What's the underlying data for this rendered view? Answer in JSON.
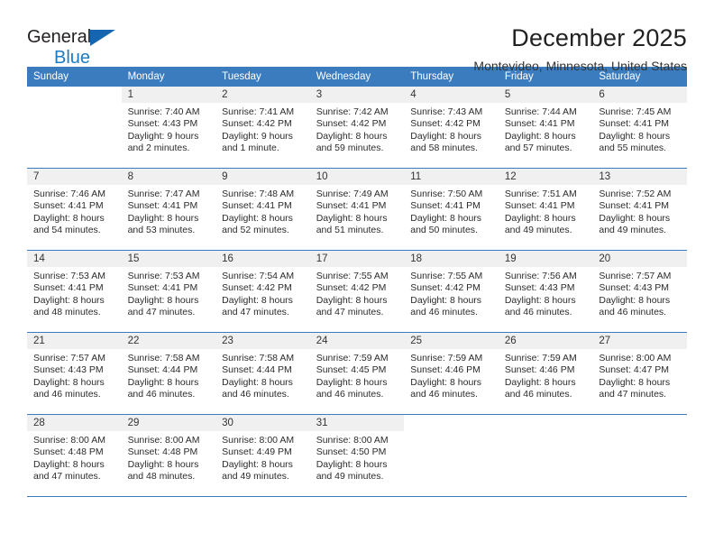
{
  "brand": {
    "name_top": "General",
    "name_bottom": "Blue",
    "triangle_color": "#1565b0",
    "bottom_color": "#1a7bc4"
  },
  "header": {
    "title": "December 2025",
    "subtitle": "Montevideo, Minnesota, United States"
  },
  "colors": {
    "header_band": "#3a7cbe",
    "daynum_band": "#f0f0f0",
    "text": "#222222"
  },
  "weekday_headers": [
    "Sunday",
    "Monday",
    "Tuesday",
    "Wednesday",
    "Thursday",
    "Friday",
    "Saturday"
  ],
  "weeks": [
    [
      {
        "day": "",
        "sunrise": "",
        "sunset": "",
        "daylight_1": "",
        "daylight_2": ""
      },
      {
        "day": "1",
        "sunrise": "Sunrise: 7:40 AM",
        "sunset": "Sunset: 4:43 PM",
        "daylight_1": "Daylight: 9 hours",
        "daylight_2": "and 2 minutes."
      },
      {
        "day": "2",
        "sunrise": "Sunrise: 7:41 AM",
        "sunset": "Sunset: 4:42 PM",
        "daylight_1": "Daylight: 9 hours",
        "daylight_2": "and 1 minute."
      },
      {
        "day": "3",
        "sunrise": "Sunrise: 7:42 AM",
        "sunset": "Sunset: 4:42 PM",
        "daylight_1": "Daylight: 8 hours",
        "daylight_2": "and 59 minutes."
      },
      {
        "day": "4",
        "sunrise": "Sunrise: 7:43 AM",
        "sunset": "Sunset: 4:42 PM",
        "daylight_1": "Daylight: 8 hours",
        "daylight_2": "and 58 minutes."
      },
      {
        "day": "5",
        "sunrise": "Sunrise: 7:44 AM",
        "sunset": "Sunset: 4:41 PM",
        "daylight_1": "Daylight: 8 hours",
        "daylight_2": "and 57 minutes."
      },
      {
        "day": "6",
        "sunrise": "Sunrise: 7:45 AM",
        "sunset": "Sunset: 4:41 PM",
        "daylight_1": "Daylight: 8 hours",
        "daylight_2": "and 55 minutes."
      }
    ],
    [
      {
        "day": "7",
        "sunrise": "Sunrise: 7:46 AM",
        "sunset": "Sunset: 4:41 PM",
        "daylight_1": "Daylight: 8 hours",
        "daylight_2": "and 54 minutes."
      },
      {
        "day": "8",
        "sunrise": "Sunrise: 7:47 AM",
        "sunset": "Sunset: 4:41 PM",
        "daylight_1": "Daylight: 8 hours",
        "daylight_2": "and 53 minutes."
      },
      {
        "day": "9",
        "sunrise": "Sunrise: 7:48 AM",
        "sunset": "Sunset: 4:41 PM",
        "daylight_1": "Daylight: 8 hours",
        "daylight_2": "and 52 minutes."
      },
      {
        "day": "10",
        "sunrise": "Sunrise: 7:49 AM",
        "sunset": "Sunset: 4:41 PM",
        "daylight_1": "Daylight: 8 hours",
        "daylight_2": "and 51 minutes."
      },
      {
        "day": "11",
        "sunrise": "Sunrise: 7:50 AM",
        "sunset": "Sunset: 4:41 PM",
        "daylight_1": "Daylight: 8 hours",
        "daylight_2": "and 50 minutes."
      },
      {
        "day": "12",
        "sunrise": "Sunrise: 7:51 AM",
        "sunset": "Sunset: 4:41 PM",
        "daylight_1": "Daylight: 8 hours",
        "daylight_2": "and 49 minutes."
      },
      {
        "day": "13",
        "sunrise": "Sunrise: 7:52 AM",
        "sunset": "Sunset: 4:41 PM",
        "daylight_1": "Daylight: 8 hours",
        "daylight_2": "and 49 minutes."
      }
    ],
    [
      {
        "day": "14",
        "sunrise": "Sunrise: 7:53 AM",
        "sunset": "Sunset: 4:41 PM",
        "daylight_1": "Daylight: 8 hours",
        "daylight_2": "and 48 minutes."
      },
      {
        "day": "15",
        "sunrise": "Sunrise: 7:53 AM",
        "sunset": "Sunset: 4:41 PM",
        "daylight_1": "Daylight: 8 hours",
        "daylight_2": "and 47 minutes."
      },
      {
        "day": "16",
        "sunrise": "Sunrise: 7:54 AM",
        "sunset": "Sunset: 4:42 PM",
        "daylight_1": "Daylight: 8 hours",
        "daylight_2": "and 47 minutes."
      },
      {
        "day": "17",
        "sunrise": "Sunrise: 7:55 AM",
        "sunset": "Sunset: 4:42 PM",
        "daylight_1": "Daylight: 8 hours",
        "daylight_2": "and 47 minutes."
      },
      {
        "day": "18",
        "sunrise": "Sunrise: 7:55 AM",
        "sunset": "Sunset: 4:42 PM",
        "daylight_1": "Daylight: 8 hours",
        "daylight_2": "and 46 minutes."
      },
      {
        "day": "19",
        "sunrise": "Sunrise: 7:56 AM",
        "sunset": "Sunset: 4:43 PM",
        "daylight_1": "Daylight: 8 hours",
        "daylight_2": "and 46 minutes."
      },
      {
        "day": "20",
        "sunrise": "Sunrise: 7:57 AM",
        "sunset": "Sunset: 4:43 PM",
        "daylight_1": "Daylight: 8 hours",
        "daylight_2": "and 46 minutes."
      }
    ],
    [
      {
        "day": "21",
        "sunrise": "Sunrise: 7:57 AM",
        "sunset": "Sunset: 4:43 PM",
        "daylight_1": "Daylight: 8 hours",
        "daylight_2": "and 46 minutes."
      },
      {
        "day": "22",
        "sunrise": "Sunrise: 7:58 AM",
        "sunset": "Sunset: 4:44 PM",
        "daylight_1": "Daylight: 8 hours",
        "daylight_2": "and 46 minutes."
      },
      {
        "day": "23",
        "sunrise": "Sunrise: 7:58 AM",
        "sunset": "Sunset: 4:44 PM",
        "daylight_1": "Daylight: 8 hours",
        "daylight_2": "and 46 minutes."
      },
      {
        "day": "24",
        "sunrise": "Sunrise: 7:59 AM",
        "sunset": "Sunset: 4:45 PM",
        "daylight_1": "Daylight: 8 hours",
        "daylight_2": "and 46 minutes."
      },
      {
        "day": "25",
        "sunrise": "Sunrise: 7:59 AM",
        "sunset": "Sunset: 4:46 PM",
        "daylight_1": "Daylight: 8 hours",
        "daylight_2": "and 46 minutes."
      },
      {
        "day": "26",
        "sunrise": "Sunrise: 7:59 AM",
        "sunset": "Sunset: 4:46 PM",
        "daylight_1": "Daylight: 8 hours",
        "daylight_2": "and 46 minutes."
      },
      {
        "day": "27",
        "sunrise": "Sunrise: 8:00 AM",
        "sunset": "Sunset: 4:47 PM",
        "daylight_1": "Daylight: 8 hours",
        "daylight_2": "and 47 minutes."
      }
    ],
    [
      {
        "day": "28",
        "sunrise": "Sunrise: 8:00 AM",
        "sunset": "Sunset: 4:48 PM",
        "daylight_1": "Daylight: 8 hours",
        "daylight_2": "and 47 minutes."
      },
      {
        "day": "29",
        "sunrise": "Sunrise: 8:00 AM",
        "sunset": "Sunset: 4:48 PM",
        "daylight_1": "Daylight: 8 hours",
        "daylight_2": "and 48 minutes."
      },
      {
        "day": "30",
        "sunrise": "Sunrise: 8:00 AM",
        "sunset": "Sunset: 4:49 PM",
        "daylight_1": "Daylight: 8 hours",
        "daylight_2": "and 49 minutes."
      },
      {
        "day": "31",
        "sunrise": "Sunrise: 8:00 AM",
        "sunset": "Sunset: 4:50 PM",
        "daylight_1": "Daylight: 8 hours",
        "daylight_2": "and 49 minutes."
      },
      {
        "day": "",
        "sunrise": "",
        "sunset": "",
        "daylight_1": "",
        "daylight_2": ""
      },
      {
        "day": "",
        "sunrise": "",
        "sunset": "",
        "daylight_1": "",
        "daylight_2": ""
      },
      {
        "day": "",
        "sunrise": "",
        "sunset": "",
        "daylight_1": "",
        "daylight_2": ""
      }
    ]
  ]
}
